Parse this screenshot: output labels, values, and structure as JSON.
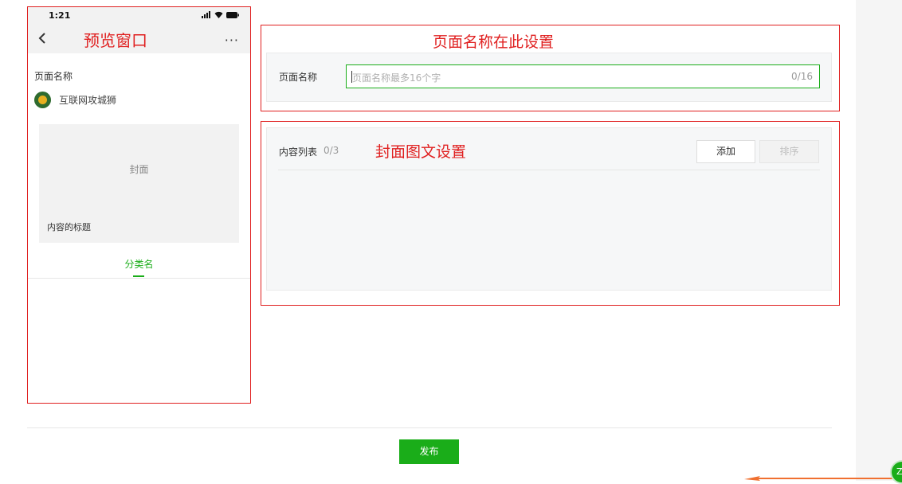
{
  "phone": {
    "status_time": "1:21",
    "nav_title": "预览窗口",
    "more": "···",
    "page_name": "页面名称",
    "account_name": "互联网攻城狮",
    "cover_label": "封面",
    "cover_title": "内容的标题",
    "category_tab": "分类名"
  },
  "name_section": {
    "annotation": "页面名称在此设置",
    "label": "页面名称",
    "placeholder": "页面名称最多16个字",
    "count": "0/16"
  },
  "content_section": {
    "label": "内容列表",
    "count": "0/3",
    "annotation": "封面图文设置",
    "add_button": "添加",
    "sort_button": "排序"
  },
  "footer": {
    "publish_button": "发布"
  },
  "colors": {
    "accent": "#1aad19",
    "annotation": "#e02020"
  }
}
